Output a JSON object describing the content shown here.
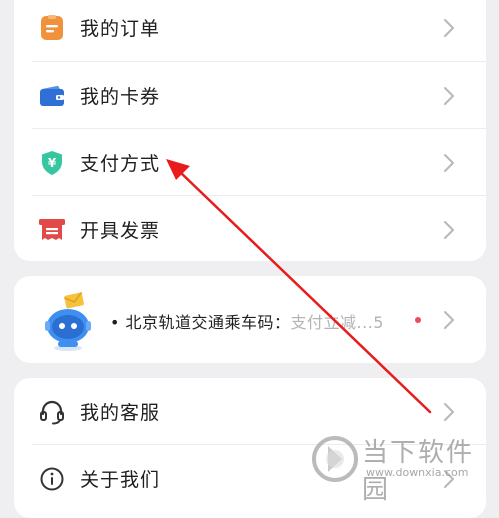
{
  "menu_main": [
    {
      "label": "我的订单",
      "icon": "order-icon"
    },
    {
      "label": "我的卡券",
      "icon": "wallet-card-icon"
    },
    {
      "label": "支付方式",
      "icon": "yuan-shield-icon"
    },
    {
      "label": "开具发票",
      "icon": "invoice-icon"
    }
  ],
  "promo": {
    "bullet": "•",
    "text": "北京轨道交通乘车码：",
    "text_faded": "支付立减...5"
  },
  "menu_service": [
    {
      "label": "我的客服",
      "icon": "headset-icon"
    },
    {
      "label": "关于我们",
      "icon": "info-icon"
    }
  ],
  "watermark": {
    "name": "当下软件园",
    "url": "www.downxia.com"
  },
  "colors": {
    "background": "#efeff1",
    "card": "#ffffff",
    "order_icon": "#f0913c",
    "wallet_icon": "#2f6fd6",
    "pay_icon": "#36c7a0",
    "invoice_icon": "#e24a4a",
    "annotation_arrow": "#e81c1c"
  }
}
